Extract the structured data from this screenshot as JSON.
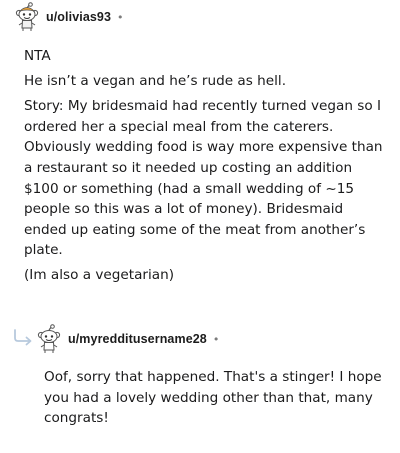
{
  "comments": [
    {
      "username": "u/olivias93",
      "separator": "•",
      "avatar_icon": "snoo-avatar-icon",
      "paragraphs": [
        "NTA",
        "He isn’t a vegan and he’s rude as hell.",
        "Story: My bridesmaid had recently turned vegan so I ordered her a special meal from the caterers. Obviously wedding food is way more expensive than a restaurant so it needed up costing an addition $100 or something (had a small wedding of ~15 people so this was a lot of money). Bridesmaid ended up eating some of the meat from another’s plate.",
        "(Im also a vegetarian)"
      ]
    },
    {
      "username": "u/myredditusername28",
      "separator": "•",
      "avatar_icon": "snoo-avatar-icon",
      "reply_icon": "reply-arrow-icon",
      "paragraphs": [
        "Oof, sorry that happened. That's a stinger! I hope you had a lovely wedding other than that, many congrats!"
      ]
    }
  ],
  "colors": {
    "text": "#1a1a1b",
    "muted": "#7c7c7c",
    "reply_arrow": "#b7c9dd"
  }
}
